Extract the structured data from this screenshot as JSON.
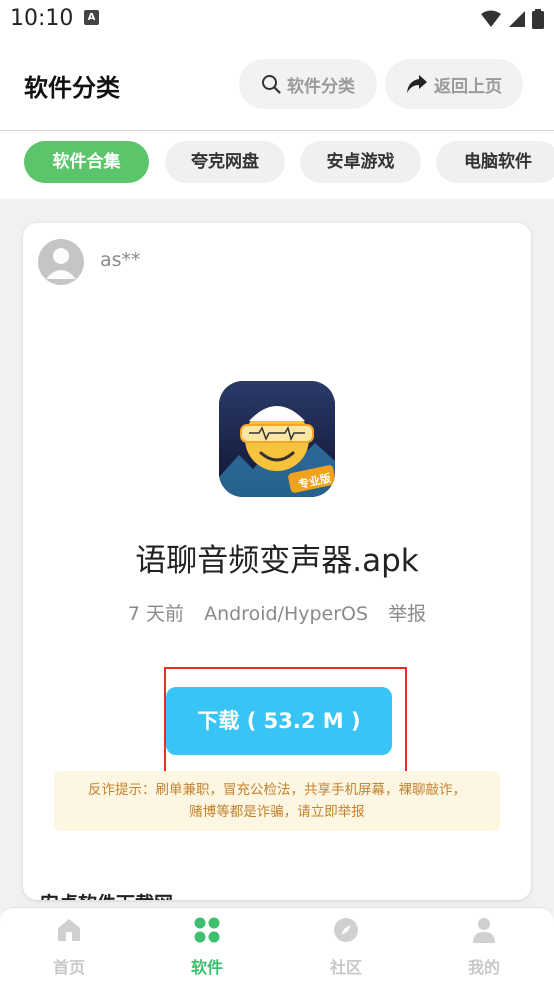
{
  "status_bar": {
    "time": "10:10",
    "notification_badge": "A"
  },
  "header": {
    "title": "软件分类",
    "search_label": "软件分类",
    "back_label": "返回上页"
  },
  "tabs": [
    {
      "label": "软件合集",
      "active": true
    },
    {
      "label": "夸克网盘",
      "active": false
    },
    {
      "label": "安卓游戏",
      "active": false
    },
    {
      "label": "电脑软件",
      "active": false
    }
  ],
  "card": {
    "username": "as**",
    "app_icon": {
      "name": "voice-changer-app-icon",
      "badge": "专业版"
    },
    "filename": "语聊音频变声器.apk",
    "meta": {
      "time": "7 天前",
      "platform": "Android/HyperOS",
      "report": "举报"
    },
    "download_label": "下载 ( 53.2 M )",
    "warning_line1": "反诈提示：刷单兼职，冒充公检法，共享手机屏幕，裸聊敲诈，",
    "warning_line2": "赌博等都是诈骗，请立即举报",
    "section_peek": "安卓软件下载网"
  },
  "bottom_nav": [
    {
      "label": "首页",
      "icon": "home-icon",
      "active": false
    },
    {
      "label": "软件",
      "icon": "apps-grid-icon",
      "active": true
    },
    {
      "label": "社区",
      "icon": "compass-icon",
      "active": false
    },
    {
      "label": "我的",
      "icon": "user-icon",
      "active": false
    }
  ],
  "colors": {
    "accent_green": "#5cc46a",
    "download_blue": "#38c4f5",
    "highlight_red": "#e5302a",
    "warning_bg": "#fdf6e2",
    "warning_text": "#c4822e"
  }
}
